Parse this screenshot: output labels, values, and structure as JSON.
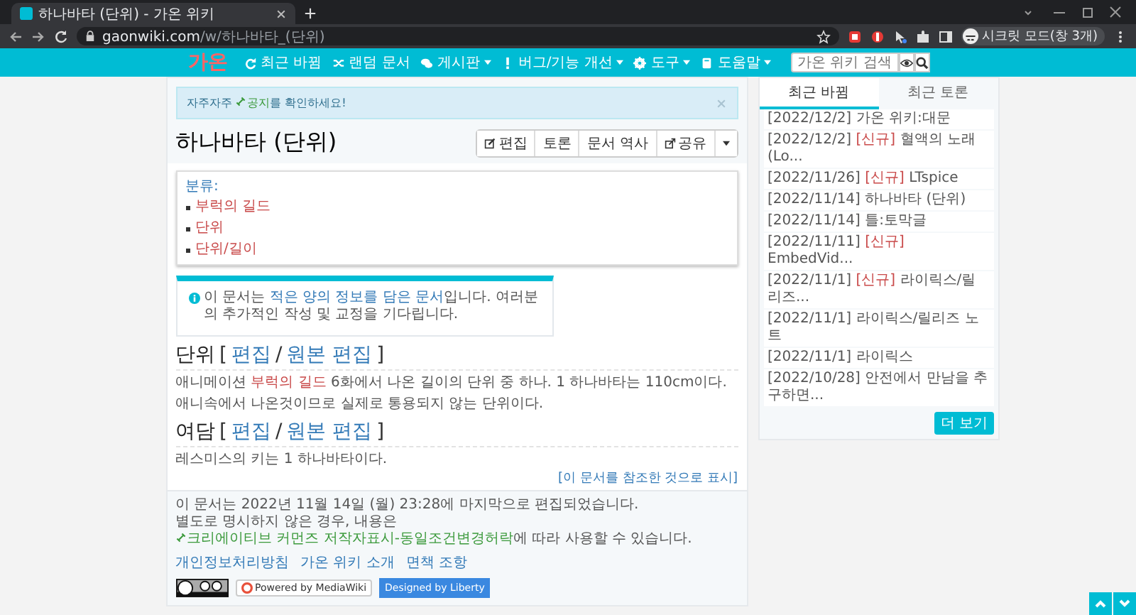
{
  "browser": {
    "tab_title": "하나바타 (단위) - 가온 위키",
    "url_host": "gaonwiki.com",
    "url_path": "/w/하나바타_(단위)",
    "profile": "시크릿 모드(창 3개)"
  },
  "nav": {
    "logo": "가온",
    "items": [
      {
        "label": "최근 바뀜",
        "dropdown": false
      },
      {
        "label": "랜덤 문서",
        "dropdown": false
      },
      {
        "label": "게시판",
        "dropdown": true
      },
      {
        "label": "버그/기능 개선",
        "dropdown": true
      },
      {
        "label": "도구",
        "dropdown": true
      },
      {
        "label": "도움말",
        "dropdown": true
      }
    ],
    "search": {
      "placeholder": "가온 위키 검색"
    }
  },
  "notice": {
    "before": "자주자주 ",
    "link": "공지",
    "after": "를 확인하세요!"
  },
  "page": {
    "title": "하나바타 (단위)",
    "actions": [
      {
        "label": "편집"
      },
      {
        "label": "토론"
      },
      {
        "label": "문서 역사"
      },
      {
        "label": "공유"
      }
    ]
  },
  "categories": {
    "label": "분류:",
    "items": [
      "부럭의 길드",
      "단위",
      "단위/길이"
    ]
  },
  "info_box": [
    {
      "kind": "text",
      "text": "이 문서는 "
    },
    {
      "kind": "link",
      "text": "적은 양의 정보를 담은 문서"
    },
    {
      "kind": "text",
      "text": "입니다. 여러분의 추가적인 작성 및 교정을 기다립니다."
    }
  ],
  "sections": [
    {
      "heading": "단위",
      "open": "[",
      "edit": "편집",
      "sep": "/",
      "source_edit": "원본 편집",
      "close": "]",
      "paragraphs": [
        [
          {
            "kind": "text",
            "text": "애니메이션 "
          },
          {
            "kind": "redlink",
            "text": "부럭의 길드"
          },
          {
            "kind": "text",
            "text": " 6화에서 나온 길이의 단위 중 하나. 1 하나바타는 110cm이다."
          }
        ],
        [
          {
            "kind": "text",
            "text": "애니속에서 나온것이므로 실제로 통용되지 않는 단위이다."
          }
        ]
      ]
    },
    {
      "heading": "여담",
      "open": "[",
      "edit": "편집",
      "sep": "/",
      "source_edit": "원본 편집",
      "close": "]",
      "paragraphs": [
        [
          {
            "kind": "text",
            "text": "레스미스의 키는 1 하나바타이다."
          }
        ]
      ]
    }
  ],
  "ref_link": "[이 문서를 참조한 것으로 표시]",
  "footer": {
    "lines": [
      [
        {
          "kind": "text",
          "text": "이 문서는 2022년 11월 14일 (월) 23:28에 마지막으로 편집되었습니다."
        }
      ],
      [
        {
          "kind": "text",
          "text": "별도로 명시하지 않은 경우, 내용은 "
        },
        {
          "kind": "license",
          "text": "크리에이티브 커먼즈 저작자표시-동일조건변경허락"
        },
        {
          "kind": "text",
          "text": "에 따라 사용할 수 있습니다."
        }
      ]
    ],
    "links": [
      "개인정보처리방침",
      "가온 위키 소개",
      "면책 조항"
    ],
    "badges": [
      {
        "kind": "cc"
      },
      {
        "kind": "mediawiki",
        "text": "Powered by MediaWiki"
      },
      {
        "kind": "liberty",
        "text": "Designed by Liberty"
      }
    ]
  },
  "sidebar": {
    "tabs": [
      {
        "label": "최근 바뀜",
        "selected": true
      },
      {
        "label": "최근 토론",
        "selected": false
      }
    ],
    "items": [
      {
        "date": "[2022/12/2]",
        "title": "가온 위키:대문"
      },
      {
        "date": "[2022/12/2]",
        "tag": "[신규]",
        "title": "혈액의 노래(Lo..."
      },
      {
        "date": "[2022/11/26]",
        "tag": "[신규]",
        "title": "LTspice"
      },
      {
        "date": "[2022/11/14]",
        "title": "하나바타 (단위)"
      },
      {
        "date": "[2022/11/14]",
        "title": "틀:토막글"
      },
      {
        "date": "[2022/11/11]",
        "tag": "[신규]",
        "title": "EmbedVid..."
      },
      {
        "date": "[2022/11/1]",
        "tag": "[신규]",
        "title": "라이릭스/릴리즈..."
      },
      {
        "date": "[2022/11/1]",
        "title": "라이릭스/릴리즈 노트"
      },
      {
        "date": "[2022/11/1]",
        "title": "라이릭스"
      },
      {
        "date": "[2022/10/28]",
        "title": "안전에서 만남을 추구하면..."
      }
    ],
    "more": "더 보기"
  }
}
